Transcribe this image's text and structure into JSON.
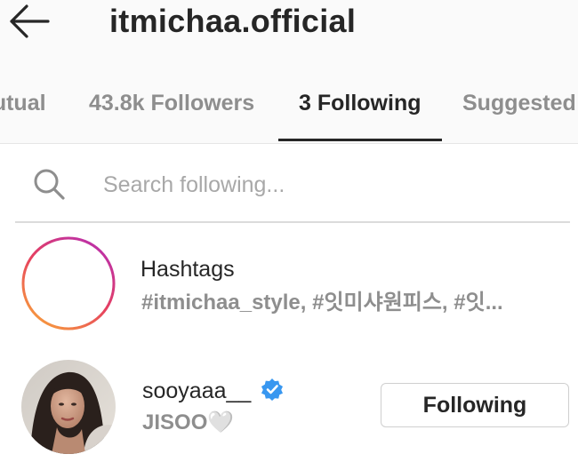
{
  "header": {
    "title": "itmichaa.official",
    "back_icon": "arrow-left-icon"
  },
  "tabs": [
    {
      "label": "Mutual",
      "active": false
    },
    {
      "label": "43.8k Followers",
      "active": false
    },
    {
      "label": "3 Following",
      "active": true
    },
    {
      "label": "Suggested",
      "active": false
    }
  ],
  "search": {
    "icon": "search-icon",
    "placeholder": "Search following...",
    "value": ""
  },
  "list": {
    "hashtags": {
      "icon": "hashtag-icon",
      "title": "Hashtags",
      "subtitle": "#itmichaa_style, #잇미샤원피스, #잇..."
    },
    "user": {
      "avatar": "profile-photo",
      "username": "sooyaaa__",
      "verified": true,
      "verified_icon": "verified-badge-icon",
      "display_name": "JISOO🤍",
      "button_label": "Following"
    }
  },
  "colors": {
    "text_primary": "#262626",
    "text_secondary": "#8e8e8e",
    "verified_blue": "#3897f0",
    "hashtag_gradient": [
      "#d6249f",
      "#fd5949",
      "#fdb54f"
    ]
  }
}
